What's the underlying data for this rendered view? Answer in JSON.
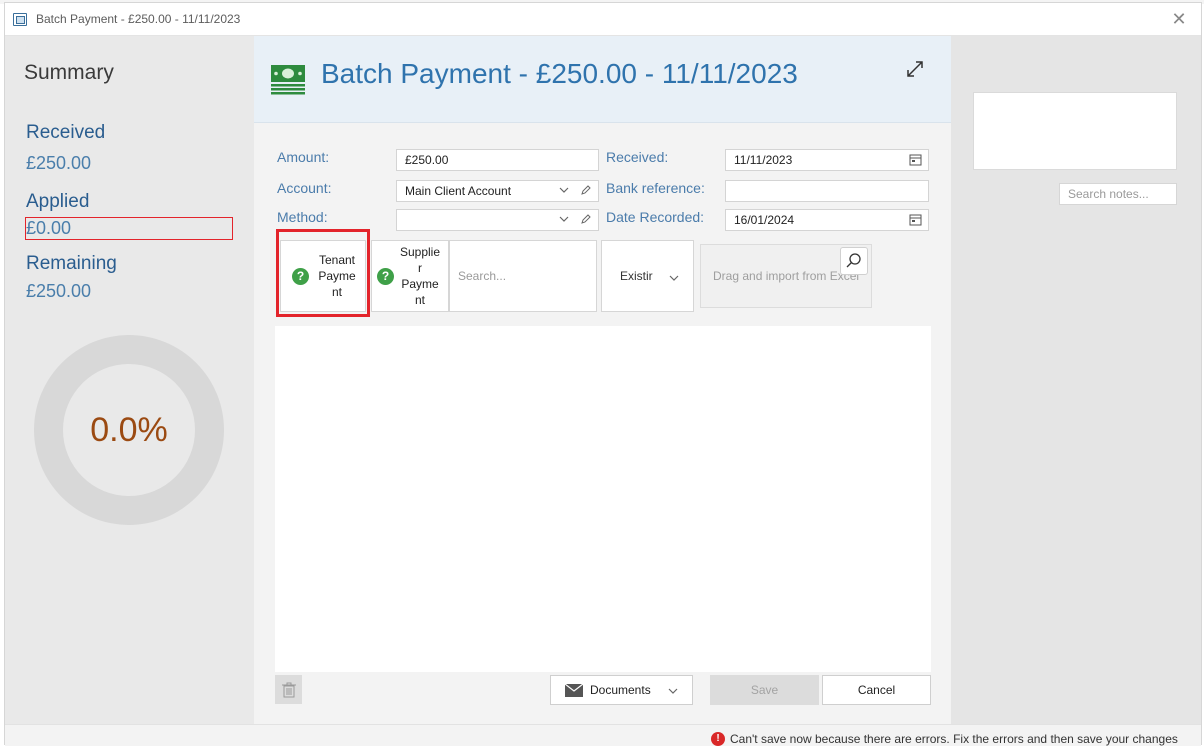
{
  "window": {
    "title": "Batch Payment - £250.00 - 11/11/2023",
    "close_glyph": "✕"
  },
  "summary": {
    "title": "Summary",
    "received_label": "Received",
    "received_value": "£250.00",
    "applied_label": "Applied",
    "applied_value": "£0.00",
    "remaining_label": "Remaining",
    "remaining_value": "£250.00",
    "percent": "0.0%",
    "applied_fraction": 0.0
  },
  "header": {
    "title": "Batch Payment - £250.00 - 11/11/2023"
  },
  "form": {
    "amount_label": "Amount:",
    "amount_value": "£250.00",
    "account_label": "Account:",
    "account_value": "Main Client Account",
    "method_label": "Method:",
    "method_value": "",
    "received_label": "Received:",
    "received_value": "11/11/2023",
    "bank_ref_label": "Bank reference:",
    "bank_ref_value": "",
    "date_recorded_label": "Date Recorded:",
    "date_recorded_value": "16/01/2024"
  },
  "tiles": {
    "tenant_lines": [
      "Tenant",
      "Payme",
      "nt"
    ],
    "supplier_lines": [
      "Supplie",
      "r",
      "Payme",
      "nt"
    ],
    "question_glyph": "?",
    "search_placeholder": "Search...",
    "existing_label": "Existir",
    "drag_text": "Drag and import from Excel"
  },
  "footer": {
    "documents_label": "Documents",
    "save_label": "Save",
    "cancel_label": "Cancel"
  },
  "notes": {
    "search_placeholder": "Search notes..."
  },
  "status": {
    "error_glyph": "!",
    "error_text": "Can't save now because there are errors. Fix the errors and then save your changes"
  },
  "colors": {
    "accent_blue": "#2f73ad",
    "error_red": "#e3242b",
    "donut_text": "#9b4a12",
    "success_green": "#3fa048"
  }
}
